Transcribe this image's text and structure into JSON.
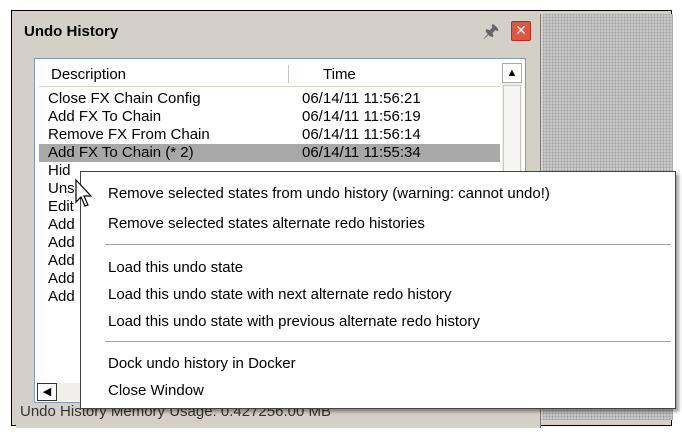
{
  "window": {
    "title": "Undo History",
    "pin_icon": "pin-icon",
    "close_icon": "close-icon"
  },
  "list": {
    "columns": [
      "Description",
      "Time"
    ],
    "rows": [
      {
        "description": "Close FX Chain Config",
        "time": "06/14/11 11:56:21"
      },
      {
        "description": "Add FX To Chain",
        "time": "06/14/11 11:56:19"
      },
      {
        "description": "Remove FX From Chain",
        "time": "06/14/11 11:56:14"
      },
      {
        "description": "Add FX To Chain (* 2)",
        "time": "06/14/11 11:55:34"
      },
      {
        "description": "Hid",
        "time": ""
      },
      {
        "description": "Uns",
        "time": ""
      },
      {
        "description": "Edit",
        "time": ""
      },
      {
        "description": "Add",
        "time": ""
      },
      {
        "description": "Add",
        "time": ""
      },
      {
        "description": "Add",
        "time": ""
      },
      {
        "description": "Add",
        "time": ""
      },
      {
        "description": "Add",
        "time": ""
      }
    ],
    "selected_index": 3
  },
  "status": "Undo History Memory Usage: 0.427256.00 MB",
  "context_menu": {
    "group1": [
      "Remove selected states from undo history (warning: cannot undo!)",
      "Remove selected states alternate redo histories"
    ],
    "group2": [
      "Load this undo state",
      "Load this undo state with next alternate redo history",
      "Load this undo state with previous alternate redo history"
    ],
    "group3": [
      "Dock undo history in Docker",
      "Close Window"
    ]
  },
  "colors": {
    "window_bg": "#d4d0c8",
    "selected_row": "#a8a8a8",
    "close_button": "#e0563f"
  }
}
